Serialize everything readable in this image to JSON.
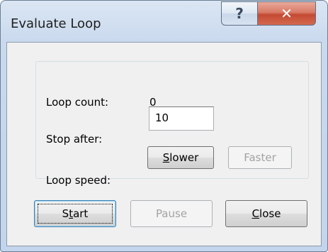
{
  "window": {
    "title": "Evaluate Loop",
    "help_glyph": "?",
    "close_glyph": "✕"
  },
  "group": {
    "loop_count_label": "Loop count:",
    "loop_count_value": "0",
    "stop_after_label": "Stop after:",
    "stop_after_value": "10",
    "loop_speed_label": "Loop speed:",
    "slower_label": "Slower",
    "faster_label": "Faster"
  },
  "buttons": {
    "start_label": "Start",
    "pause_label": "Pause",
    "close_label": "Close"
  },
  "icons": {
    "help": "help-icon",
    "close": "close-icon"
  },
  "colors": {
    "title_bar": "#c9d9ee",
    "close_button": "#c44a32",
    "default_button_border": "#3c7fb1",
    "disabled_text": "#a3a3a3"
  }
}
